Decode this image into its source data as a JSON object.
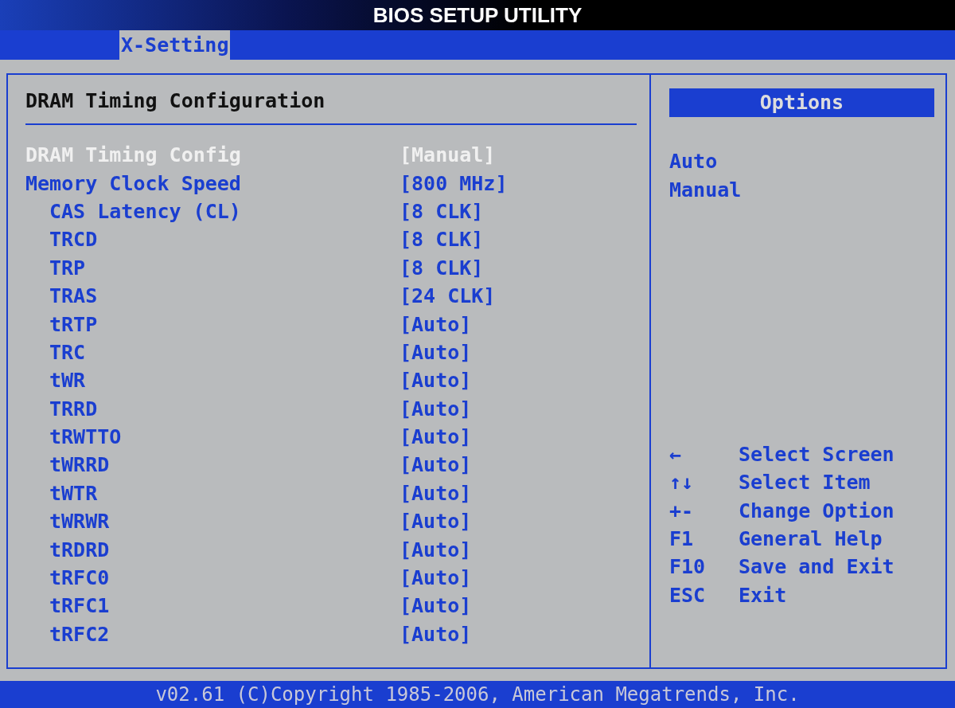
{
  "window": {
    "title": "BIOS SETUP UTILITY"
  },
  "tabs": [
    {
      "label": "X-Setting",
      "selected": true
    }
  ],
  "section": {
    "title": "DRAM Timing Configuration"
  },
  "settings": [
    {
      "label": "DRAM Timing Config",
      "value": "[Manual]",
      "selected": true
    },
    {
      "label": "Memory Clock Speed",
      "value": "[800 MHz]",
      "selected": false,
      "children": [
        {
          "label": "CAS Latency (CL)",
          "value": "[8 CLK]",
          "selected": false
        },
        {
          "label": "TRCD",
          "value": "[8 CLK]",
          "selected": false
        },
        {
          "label": "TRP",
          "value": "[8 CLK]",
          "selected": false
        },
        {
          "label": "TRAS",
          "value": "[24 CLK]",
          "selected": false
        },
        {
          "label": "tRTP",
          "value": "[Auto]",
          "selected": false
        },
        {
          "label": "TRC",
          "value": "[Auto]",
          "selected": false
        },
        {
          "label": "tWR",
          "value": "[Auto]",
          "selected": false
        },
        {
          "label": "TRRD",
          "value": "[Auto]",
          "selected": false
        },
        {
          "label": "tRWTTO",
          "value": "[Auto]",
          "selected": false
        },
        {
          "label": "tWRRD",
          "value": "[Auto]",
          "selected": false
        },
        {
          "label": "tWTR",
          "value": "[Auto]",
          "selected": false
        },
        {
          "label": "tWRWR",
          "value": "[Auto]",
          "selected": false
        },
        {
          "label": "tRDRD",
          "value": "[Auto]",
          "selected": false
        },
        {
          "label": "tRFC0",
          "value": "[Auto]",
          "selected": false
        },
        {
          "label": "tRFC1",
          "value": "[Auto]",
          "selected": false
        },
        {
          "label": "tRFC2",
          "value": "[Auto]",
          "selected": false
        }
      ]
    }
  ],
  "options_panel": {
    "title": "Options",
    "options": [
      "Auto",
      "Manual"
    ]
  },
  "help": [
    {
      "key": "←",
      "action": "Select Screen"
    },
    {
      "key": "↑↓",
      "action": "Select Item"
    },
    {
      "key": "+-",
      "action": "Change Option"
    },
    {
      "key": "F1",
      "action": "General Help"
    },
    {
      "key": "F10",
      "action": "Save and Exit"
    },
    {
      "key": "ESC",
      "action": "Exit"
    }
  ],
  "status_bar": "v02.61 (C)Copyright 1985-2006, American Megatrends, Inc."
}
